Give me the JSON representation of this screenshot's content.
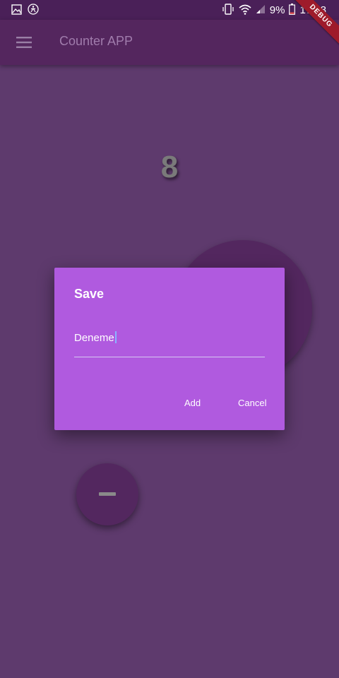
{
  "status_bar": {
    "battery_percent": "9%",
    "time": "17:48",
    "icons": [
      "gallery-icon",
      "accessibility-icon",
      "vibrate-icon",
      "wifi-icon",
      "signal-icon",
      "battery-icon"
    ]
  },
  "debug_banner": "DEBUG",
  "app_bar": {
    "menu_icon": "menu-icon",
    "title": "Counter APP"
  },
  "counter": {
    "value": "8"
  },
  "dialog": {
    "title": "Save",
    "input_value": "Deneme",
    "add_label": "Add",
    "cancel_label": "Cancel"
  },
  "fabs": {
    "minus_icon": "minus-icon"
  },
  "colors": {
    "background": "#5e3a6d",
    "app_bar": "#54265e",
    "status_bar": "#4a2058",
    "dialog": "#b05adf",
    "fab": "#53275f",
    "debug": "#9e1b2b"
  }
}
